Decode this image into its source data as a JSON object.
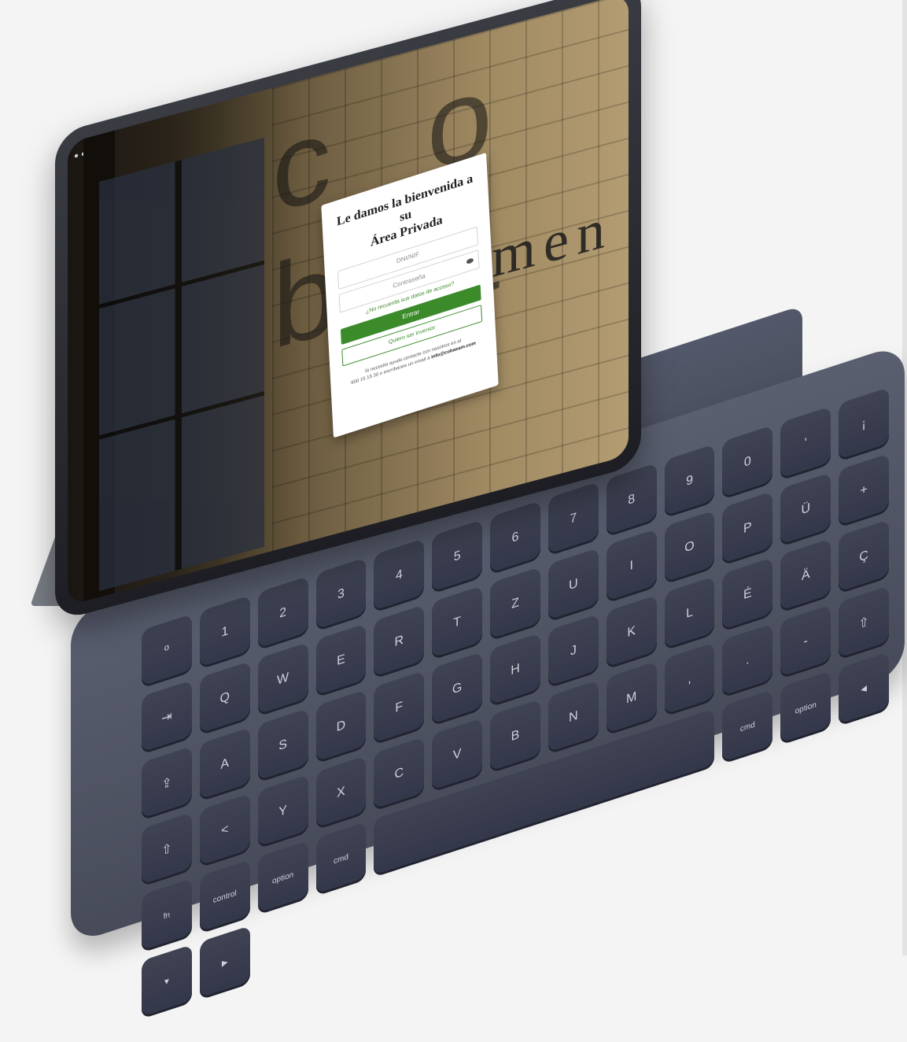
{
  "screen": {
    "brand_letters": "c o b a",
    "brand_text": "agemen",
    "login": {
      "title_line1": "Le damos la bienvenida a su",
      "title_line2": "Área Privada",
      "user_placeholder": "DNI/NIF",
      "password_placeholder": "Contraseña",
      "forgot_link": "¿No recuerda sus datos de acceso?",
      "enter_button": "Entrar",
      "become_investor_button": "Quiero ser inversor",
      "help_text_1": "Si necesita ayuda contacte con nosotros en el",
      "help_text_2": "900 15 15 30 o escríbanos un email a",
      "help_email": "info@cobasam.com"
    }
  },
  "keyboard": {
    "row1": [
      "º",
      "1",
      "2",
      "3",
      "4",
      "5",
      "6",
      "7",
      "8",
      "9",
      "0",
      "'",
      "¡"
    ],
    "row2": [
      "⇥",
      "Q",
      "W",
      "E",
      "R",
      "T",
      "Z",
      "U",
      "I",
      "O",
      "P",
      "Ü",
      "+"
    ],
    "row3": [
      "⇪",
      "A",
      "S",
      "D",
      "F",
      "G",
      "H",
      "J",
      "K",
      "L",
      "É",
      "Ä",
      "Ç"
    ],
    "row4": [
      "⇧",
      "<",
      "Y",
      "X",
      "C",
      "V",
      "B",
      "N",
      "M",
      ",",
      ".",
      "-",
      "⇧"
    ],
    "row5": [
      "fn",
      "control",
      "option",
      "cmd",
      "",
      "cmd",
      "option",
      "◀",
      "▼",
      "▶"
    ]
  },
  "colors": {
    "accent_green": "#3c8b2b",
    "keyboard": "#474b59",
    "background": "#f4f4f4"
  }
}
